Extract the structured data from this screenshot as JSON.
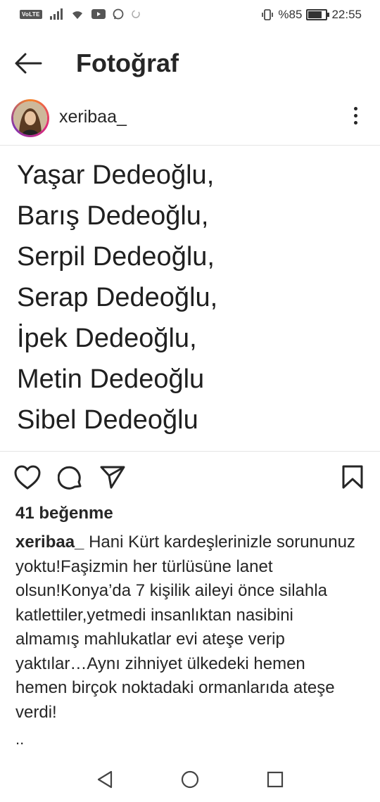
{
  "status_bar": {
    "network_badge": "VoLTE",
    "icons": [
      "signal-icon",
      "wifi-icon",
      "youtube-icon",
      "whatsapp-icon",
      "sync-icon"
    ],
    "battery_text": "%85",
    "battery_level": 0.85,
    "time": "22:55"
  },
  "header": {
    "title": "Fotoğraf",
    "back_icon": "arrow-left-icon"
  },
  "post": {
    "username": "xeribaa_",
    "image_lines": [
      "Yaşar Dedeoğlu,",
      "Barış Dedeoğlu,",
      "Serpil Dedeoğlu,",
      "Serap Dedeoğlu,",
      "İpek Dedeoğlu,",
      "Metin Dedeoğlu",
      "Sibel Dedeoğlu"
    ],
    "likes": "41 beğenme",
    "caption_user": "xeribaa_",
    "caption_text": " Hani Kürt kardeşlerinizle sorununuz yoktu!Faşizmin her türlüsüne lanet olsun!Konya’da 7 kişilik aileyi önce silahla katlettiler,yetmedi insanlıktan nasibini almamış mahlukatlar evi ateşe verip yaktılar…Aynı zihniyet ülkedeki hemen hemen birçok noktadaki ormanlarıda ateşe verdi!",
    "more_indicator": ".."
  },
  "colors": {
    "text": "#262626",
    "ring_gradient": [
      "#f58529",
      "#dd2a7b",
      "#8134af"
    ]
  }
}
